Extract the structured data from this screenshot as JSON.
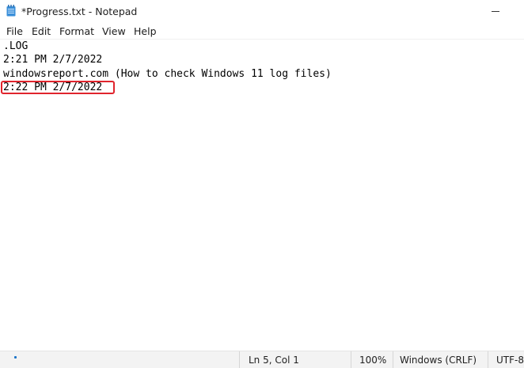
{
  "window": {
    "title": "*Progress.txt - Notepad",
    "minimize_glyph": "—"
  },
  "menu": {
    "items": [
      {
        "label": "File"
      },
      {
        "label": "Edit"
      },
      {
        "label": "Format"
      },
      {
        "label": "View"
      },
      {
        "label": "Help"
      }
    ]
  },
  "editor": {
    "lines": [
      ".LOG",
      "2:21 PM 2/7/2022",
      "windowsreport.com (How to check Windows 11 log files)",
      "2:22 PM 2/7/2022"
    ],
    "highlighted_line_index": 3
  },
  "statusbar": {
    "position": "Ln 5, Col 1",
    "zoom": "100%",
    "line_ending": "Windows (CRLF)",
    "encoding": "UTF-8"
  },
  "colors": {
    "highlight": "#e0242d",
    "icon_blue": "#3a8fd9"
  },
  "icons": {
    "app": "notepad-icon"
  }
}
